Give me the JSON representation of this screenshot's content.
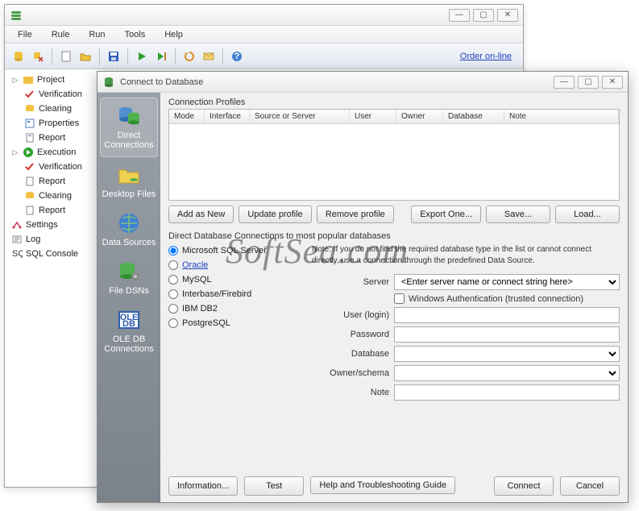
{
  "main": {
    "title": "",
    "menus": [
      "File",
      "Rule",
      "Run",
      "Tools",
      "Help"
    ],
    "order_link": "Order on-line"
  },
  "tree": {
    "project": {
      "label": "Project",
      "children": [
        "Verification",
        "Clearing",
        "Properties",
        "Report"
      ]
    },
    "execution": {
      "label": "Execution",
      "children": [
        "Verification",
        "Report",
        "Clearing",
        "Report"
      ]
    },
    "settings": "Settings",
    "log": "Log",
    "sql_console": "SQL Console"
  },
  "dialog": {
    "title": "Connect to Database",
    "sidebar": [
      {
        "label": "Direct Connections",
        "icon": "db-stack-icon"
      },
      {
        "label": "Desktop Files",
        "icon": "folder-db-icon"
      },
      {
        "label": "Data Sources",
        "icon": "globe-icon"
      },
      {
        "label": "File DSNs",
        "icon": "db-gear-icon"
      },
      {
        "label": "OLE DB Connections",
        "icon": "oledb-icon"
      }
    ],
    "profiles_label": "Connection Profiles",
    "columns": [
      "Mode",
      "Interface",
      "Source or Server",
      "User",
      "Owner",
      "Database",
      "Note"
    ],
    "buttons": {
      "add": "Add as New",
      "update": "Update profile",
      "remove": "Remove profile",
      "export": "Export One...",
      "save": "Save...",
      "load": "Load..."
    },
    "section_desc": "Direct Database Connections to most popular databases",
    "radios": [
      "Microsoft SQL Server",
      "Oracle",
      "MySQL",
      "Interbase/Firebird",
      "IBM DB2",
      "PostgreSQL"
    ],
    "note": "Note: If you do not find the required database type in the list or cannot connect directly, use a connection through the predefined Data Source.",
    "form": {
      "server_label": "Server",
      "server_placeholder": "<Enter server name or connect string here>",
      "winauth": "Windows Authentication (trusted connection)",
      "user_label": "User (login)",
      "password_label": "Password",
      "database_label": "Database",
      "owner_label": "Owner/schema",
      "note_label": "Note"
    },
    "bottom": {
      "info": "Information...",
      "test": "Test",
      "help": "Help and Troubleshooting Guide",
      "connect": "Connect",
      "cancel": "Cancel"
    }
  },
  "watermark": "SoftSea.com"
}
